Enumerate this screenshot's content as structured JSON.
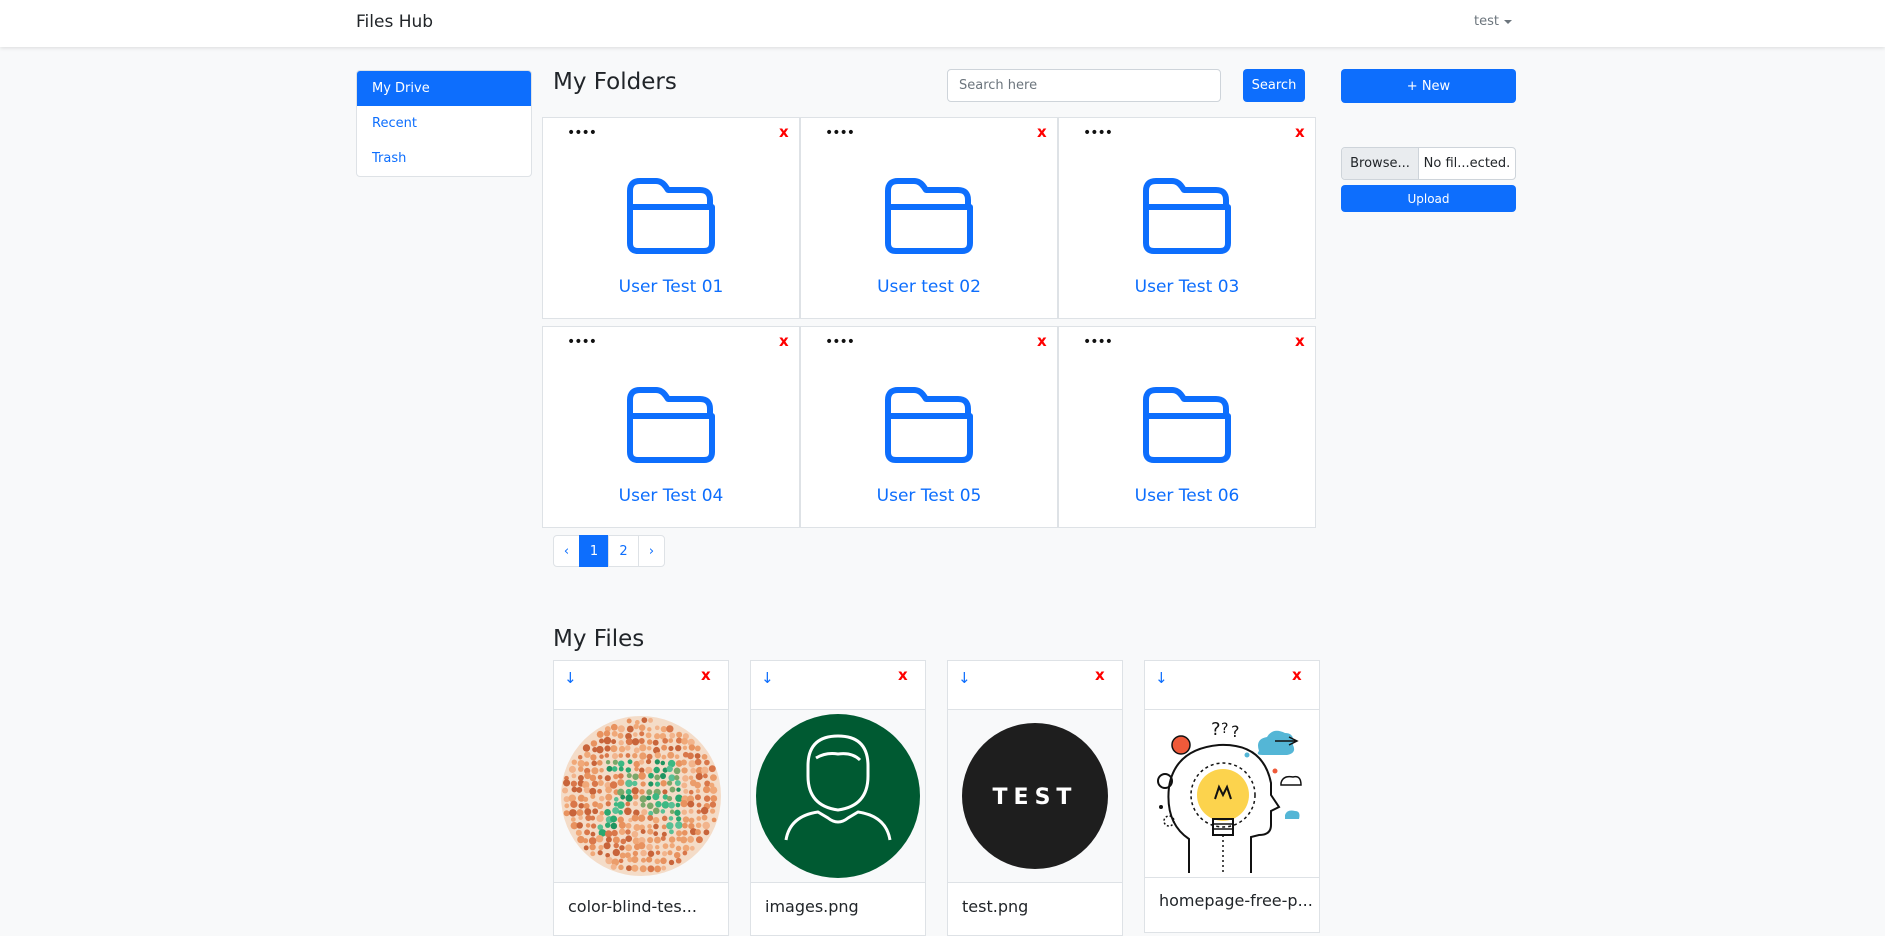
{
  "navbar": {
    "brand": "Files Hub",
    "user": "test"
  },
  "sidebar": {
    "items": [
      {
        "label": "My Drive",
        "active": true
      },
      {
        "label": "Recent",
        "active": false
      },
      {
        "label": "Trash",
        "active": false
      }
    ]
  },
  "folders_section": {
    "title": "My Folders",
    "search_placeholder": "Search here",
    "search_button": "Search",
    "more_glyph": "••••",
    "delete_glyph": "x",
    "folders": [
      "User Test 01",
      "User test 02",
      "User Test 03",
      "User Test 04",
      "User Test 05",
      "User Test 06"
    ]
  },
  "pagination": {
    "prev": "‹",
    "pages": [
      "1",
      "2"
    ],
    "current": "1",
    "next": "›"
  },
  "actions": {
    "new_button": "+ New",
    "browse_label": "Browse...",
    "file_label": "No fil...ected.",
    "upload_button": "Upload"
  },
  "files_section": {
    "title": "My Files",
    "download_glyph": "↓",
    "delete_glyph": "x",
    "files": [
      {
        "name": "color-blind-tes...",
        "icon": "color-blind-test-image"
      },
      {
        "name": "images.png",
        "icon": "user-avatar-image"
      },
      {
        "name": "test.png",
        "icon": "test-text-image",
        "image_text": "TEST"
      },
      {
        "name": "homepage-free-p...",
        "icon": "lightbulb-head-illustration"
      }
    ]
  },
  "colors": {
    "primary": "#0d6efd",
    "danger": "#ff0000",
    "avatar_green": "#005a32",
    "dark": "#1e1e1e",
    "bulb": "#fcd34d"
  }
}
